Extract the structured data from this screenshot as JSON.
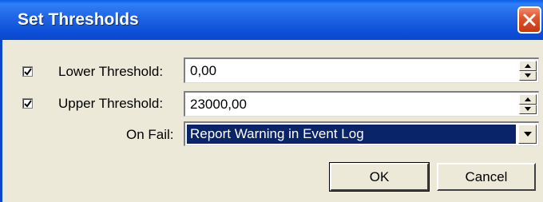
{
  "window": {
    "title": "Set Thresholds",
    "close_icon": "close-icon"
  },
  "form": {
    "lower": {
      "checked": true,
      "label": "Lower Threshold:",
      "value": "0,00"
    },
    "upper": {
      "checked": true,
      "label": "Upper Threshold:",
      "value": "23000,00"
    },
    "on_fail": {
      "label": "On Fail:",
      "selected": "Report Warning in Event Log"
    }
  },
  "buttons": {
    "ok": "OK",
    "cancel": "Cancel"
  },
  "colors": {
    "titlebar": "#0c47c8",
    "selection": "#0a246a",
    "close": "#e0552f",
    "face": "#ece9d8"
  }
}
